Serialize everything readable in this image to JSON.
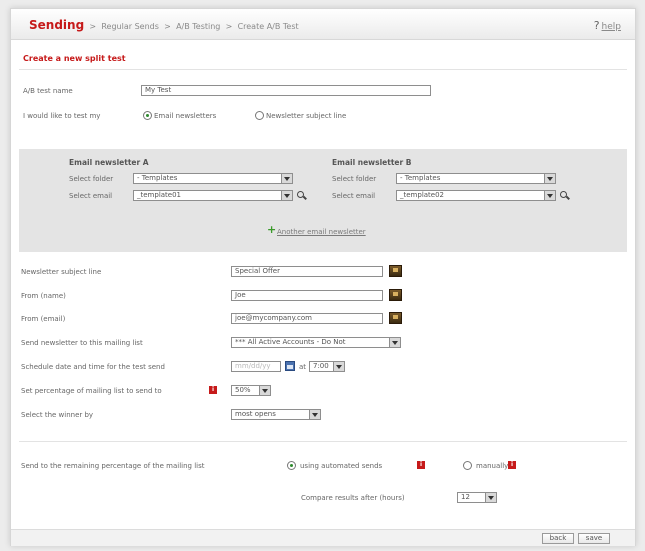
{
  "breadcrumb": {
    "root": "Sending",
    "items": [
      "Regular Sends",
      "A/B Testing",
      "Create A/B Test"
    ],
    "separator": ">"
  },
  "help": {
    "icon": "?",
    "label": "help"
  },
  "page_heading": "Create a new split test",
  "ab_name": {
    "label": "A/B test name",
    "value": "My Test"
  },
  "test_choice": {
    "label": "I would like to test my",
    "options": [
      "Email newsletters",
      "Newsletter subject line"
    ],
    "selected": "Email newsletters"
  },
  "newsletter_a": {
    "title": "Email newsletter A",
    "folder_label": "Select folder",
    "folder_value": "- Templates",
    "email_label": "Select email",
    "email_value": "_template01"
  },
  "newsletter_b": {
    "title": "Email newsletter B",
    "folder_label": "Select folder",
    "folder_value": "- Templates",
    "email_label": "Select email",
    "email_value": "_template02"
  },
  "add_newsletter_link": "Another email newsletter",
  "form": {
    "subject": {
      "label": "Newsletter subject line",
      "value": "Special Offer"
    },
    "from_name": {
      "label": "From (name)",
      "value": "Joe"
    },
    "from_email": {
      "label": "From (email)",
      "value": "joe@mycompany.com"
    },
    "mailing_list": {
      "label": "Send newsletter to this mailing list",
      "value": "*** All Active Accounts - Do Not"
    },
    "schedule": {
      "label": "Schedule date and time for the test send",
      "date_placeholder": "mm/dd/yy",
      "at_label": "at",
      "time_value": "7:00"
    },
    "percentage": {
      "label": "Set percentage of mailing list to send to",
      "value": "50%"
    },
    "winner": {
      "label": "Select the winner by",
      "value": "most opens"
    }
  },
  "remaining": {
    "label": "Send to the remaining percentage of the mailing list",
    "options": [
      "using automated sends",
      "manually"
    ],
    "selected": "using automated sends",
    "compare_label": "Compare results after (hours)",
    "compare_value": "12"
  },
  "buttons": {
    "back": "back",
    "save": "save"
  },
  "colors": {
    "accent_red": "#c61a1a",
    "radio_green": "#2f8a2f",
    "link_green": "#3a9a2a",
    "panel_gray": "#e4e4e4"
  }
}
